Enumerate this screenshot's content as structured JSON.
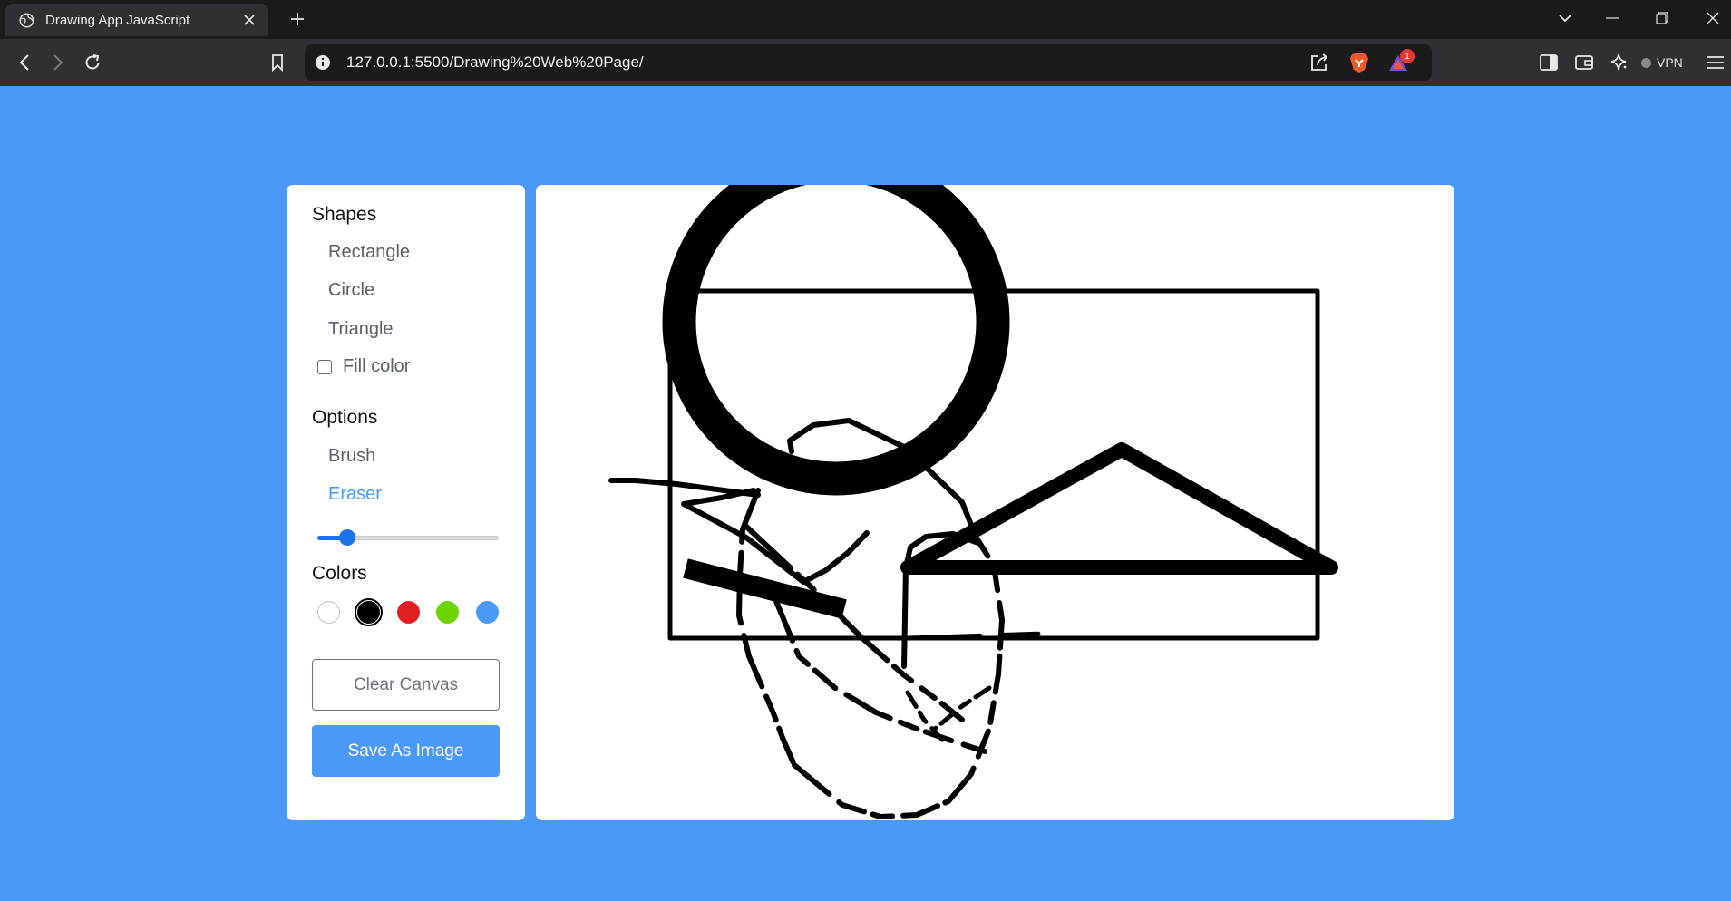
{
  "browser": {
    "tab_title": "Drawing App JavaScript",
    "url": "127.0.0.1:5500/Drawing%20Web%20Page/",
    "vpn_label": "VPN",
    "brave_badge_count": "1"
  },
  "tools": {
    "shapes_title": "Shapes",
    "shapes": [
      "Rectangle",
      "Circle",
      "Triangle"
    ],
    "fill_color_label": "Fill color",
    "fill_color_checked": false,
    "options_title": "Options",
    "options": [
      {
        "label": "Brush",
        "active": false
      },
      {
        "label": "Eraser",
        "active": true
      }
    ],
    "brush_size": 5,
    "brush_size_max": 30,
    "colors_title": "Colors",
    "colors": [
      "#ffffff",
      "#000000",
      "#e02020",
      "#6dd400",
      "#4a98f7"
    ],
    "selected_color": "#000000",
    "clear_button": "Clear Canvas",
    "save_button": "Save As Image"
  },
  "theme": {
    "background": "#4a98f7",
    "accent": "#4a98f7"
  },
  "icons": [
    "globe-icon",
    "close-icon",
    "plus-icon",
    "back-icon",
    "forward-icon",
    "reload-icon",
    "bookmark-icon",
    "info-icon",
    "share-icon",
    "brave-shield-icon",
    "brave-rewards-icon",
    "sidebar-icon",
    "wallet-icon",
    "leo-icon",
    "menu-icon"
  ]
}
